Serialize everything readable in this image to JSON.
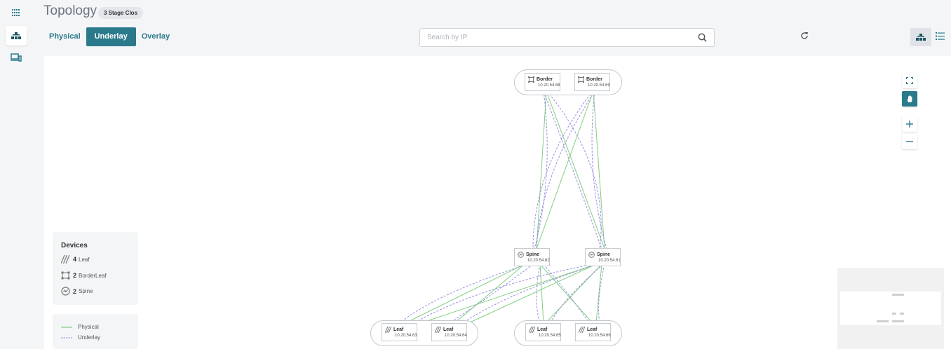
{
  "header": {
    "title": "Topology",
    "badge": "3 Stage Clos"
  },
  "tabs": [
    "Physical",
    "Underlay",
    "Overlay"
  ],
  "active_tab": "Underlay",
  "search": {
    "placeholder": "Search by IP",
    "value": ""
  },
  "rail_icons": [
    "grid-icon",
    "topology-icon",
    "devices-icon"
  ],
  "legend": {
    "title": "Devices",
    "items": [
      {
        "count": "4",
        "label": "Leaf",
        "icon": "leaf-icon"
      },
      {
        "count": "2",
        "label": "BorderLeaf",
        "icon": "borderleaf-icon"
      },
      {
        "count": "2",
        "label": "Spine",
        "icon": "spine-icon"
      }
    ],
    "links": [
      {
        "label": "Physical",
        "style": "solid",
        "color": "#7fcf7f"
      },
      {
        "label": "Underlay",
        "style": "dashed",
        "color": "#9a8ee0"
      }
    ]
  },
  "nodes": {
    "border1": {
      "role": "Border",
      "ip": "10.20.54.68"
    },
    "border2": {
      "role": "Border",
      "ip": "10.20.54.69"
    },
    "spine1": {
      "role": "Spine",
      "ip": "10.20.54.62"
    },
    "spine2": {
      "role": "Spine",
      "ip": "10.20.54.61"
    },
    "leaf1": {
      "role": "Leaf",
      "ip": "10.20.54.63"
    },
    "leaf2": {
      "role": "Leaf",
      "ip": "10.20.54.64"
    },
    "leaf3": {
      "role": "Leaf",
      "ip": "10.20.54.65"
    },
    "leaf4": {
      "role": "Leaf",
      "ip": "10.20.54.66"
    }
  },
  "colors": {
    "accent": "#2a7a8c",
    "physical": "#7fcf7f",
    "underlay": "#9a8ee0"
  }
}
